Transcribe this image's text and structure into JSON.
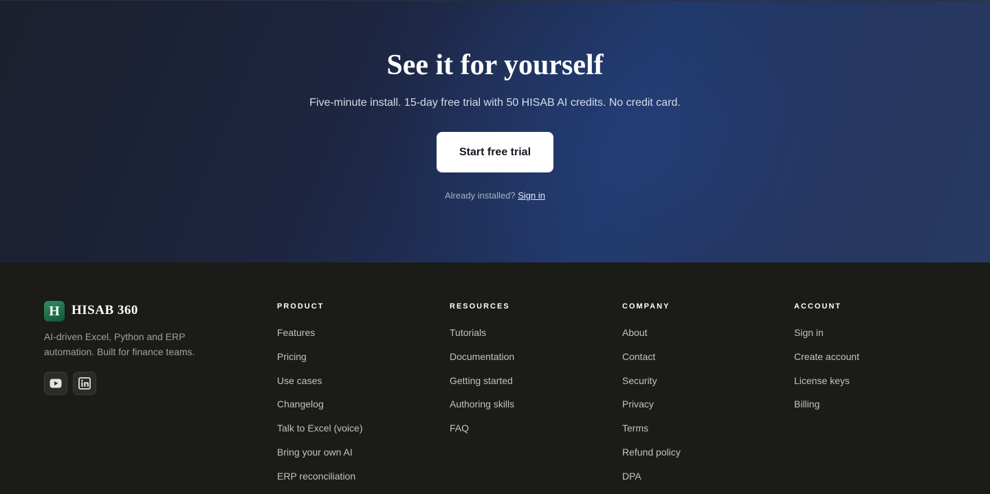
{
  "hero": {
    "title": "See it for yourself",
    "subtitle": "Five-minute install. 15-day free trial with 50 HISAB AI credits. No credit card.",
    "cta_label": "Start free trial",
    "already_text": "Already installed?",
    "signin_link": "Sign in"
  },
  "brand": {
    "logo_letter": "H",
    "name": "HISAB 360",
    "tagline": "AI-driven Excel, Python and ERP automation. Built for finance teams."
  },
  "social": [
    {
      "icon": "youtube-icon"
    },
    {
      "icon": "linkedin-icon"
    }
  ],
  "footer_columns": [
    {
      "heading": "PRODUCT",
      "links": [
        "Features",
        "Pricing",
        "Use cases",
        "Changelog",
        "Talk to Excel (voice)",
        "Bring your own AI",
        "ERP reconciliation"
      ]
    },
    {
      "heading": "RESOURCES",
      "links": [
        "Tutorials",
        "Documentation",
        "Getting started",
        "Authoring skills",
        "FAQ"
      ]
    },
    {
      "heading": "COMPANY",
      "links": [
        "About",
        "Contact",
        "Security",
        "Privacy",
        "Terms",
        "Refund policy",
        "DPA"
      ]
    },
    {
      "heading": "ACCOUNT",
      "links": [
        "Sign in",
        "Create account",
        "License keys",
        "Billing"
      ]
    }
  ],
  "colors": {
    "hero_bg": "#1d2540",
    "footer_bg": "#1b1b17",
    "brand_green": "#2f8f5e",
    "button_bg": "#ffffff"
  }
}
